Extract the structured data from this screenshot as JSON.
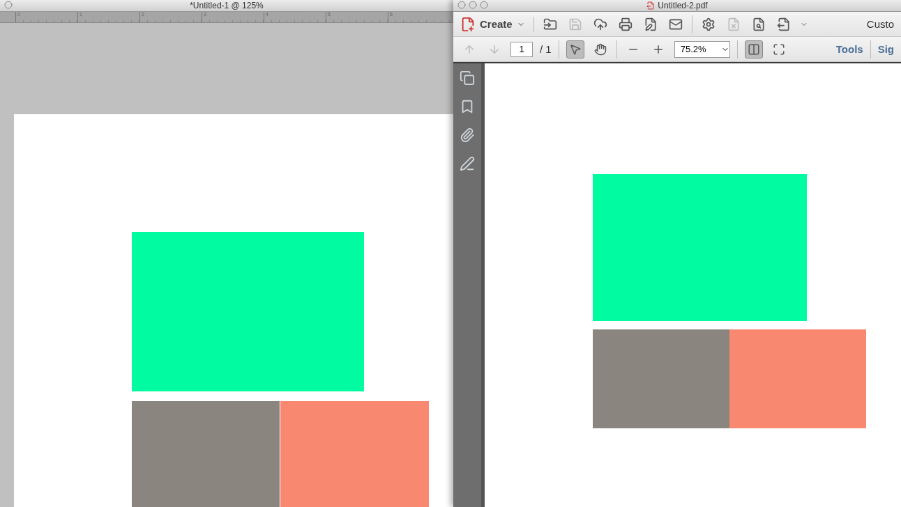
{
  "editor_window": {
    "title": "*Untitled-1 @ 125%",
    "ruler_labels": [
      "0",
      "1",
      "2",
      "3",
      "4",
      "5",
      "6"
    ],
    "shapes": [
      {
        "color": "#00fba0"
      },
      {
        "color": "#8a857e"
      },
      {
        "color": "#f98870"
      }
    ]
  },
  "pdf_window": {
    "title": "Untitled-2.pdf",
    "toolbar": {
      "create_label": "Create",
      "tools": [
        {
          "kind": "open",
          "disabled": false
        },
        {
          "kind": "save",
          "disabled": true
        },
        {
          "kind": "upload",
          "disabled": false
        },
        {
          "kind": "print",
          "disabled": false
        },
        {
          "kind": "edit",
          "disabled": false
        },
        {
          "kind": "mail",
          "disabled": false
        },
        {
          "kind": "settings",
          "disabled": false
        },
        {
          "kind": "delete",
          "disabled": true
        },
        {
          "kind": "search",
          "disabled": false
        },
        {
          "kind": "export",
          "disabled": false
        }
      ],
      "customize_label": "Custo"
    },
    "nav_bar": {
      "page_value": "1",
      "page_total": "/ 1",
      "zoom_value": "75.2%",
      "tools": [
        {
          "kind": "select",
          "selected": true
        },
        {
          "kind": "hand",
          "selected": false
        }
      ],
      "view_tools": [
        {
          "kind": "fit-page",
          "selected": true
        },
        {
          "kind": "full-screen",
          "selected": false
        }
      ],
      "tools_label": "Tools",
      "sign_label": "Sig"
    },
    "sidebar": [
      {
        "kind": "pages"
      },
      {
        "kind": "bookmarks"
      },
      {
        "kind": "attachments"
      },
      {
        "kind": "signatures"
      }
    ],
    "shapes": [
      {
        "color": "#00fba0"
      },
      {
        "color": "#8a857e"
      },
      {
        "color": "#f98870"
      }
    ]
  }
}
